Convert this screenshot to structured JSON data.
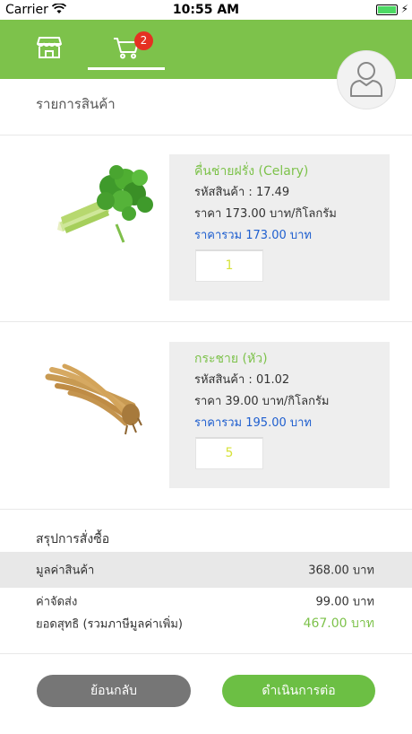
{
  "status_bar": {
    "carrier": "Carrier",
    "time": "10:55 AM"
  },
  "nav": {
    "tabs": [
      {
        "icon": "store-icon"
      },
      {
        "icon": "cart-icon",
        "badge": "2",
        "active": true
      }
    ]
  },
  "page": {
    "title": "รายการสินค้า"
  },
  "cart": {
    "items": [
      {
        "name": "คื่นช่ายฝรั่ง (Celary)",
        "code": "รหัสสินค้า : 17.49",
        "price": "ราคา 173.00 บาท/กิโลกรัม",
        "total": "ราคารวม 173.00 บาท",
        "quantity": "1",
        "image": "celery-image"
      },
      {
        "name": "กระชาย (หัว)",
        "code": "รหัสสินค้า : 01.02",
        "price": "ราคา 39.00 บาท/กิโลกรัม",
        "total": "ราคารวม 195.00 บาท",
        "quantity": "5",
        "image": "fingerroot-image"
      }
    ]
  },
  "summary": {
    "title": "สรุปการสั่งซื้อ",
    "subtotal_label": "มูลค่าสินค้า",
    "subtotal_value": "368.00 บาท",
    "shipping_label": "ค่าจัดส่ง",
    "shipping_value": "99.00 บาท",
    "grand_total_label": "ยอดสุทธิ (รวมภาษีมูลค่าเพิ่ม)",
    "grand_total_value": "467.00 บาท"
  },
  "actions": {
    "back_label": "ย้อนกลับ",
    "continue_label": "ดำเนินการต่อ"
  },
  "colors": {
    "brand_green": "#7dc24b",
    "badge_red": "#e53122",
    "total_blue": "#1f5fcf",
    "back_gray": "#767676"
  }
}
